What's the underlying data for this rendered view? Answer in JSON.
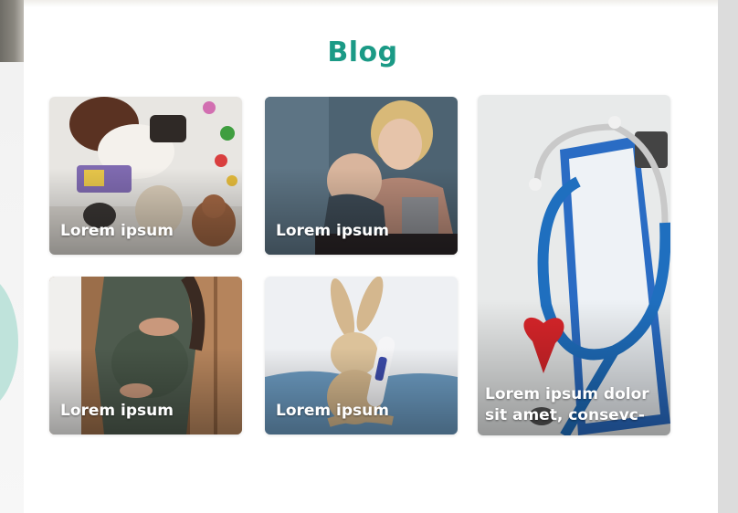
{
  "blog": {
    "title": "Blog",
    "posts": [
      {
        "caption": "Lorem ipsum",
        "image": "child-playing-with-toys"
      },
      {
        "caption": "Lorem ipsum",
        "image": "mother-holding-baby"
      },
      {
        "caption": "Lorem ipsum dolor sit amet, consevc-",
        "image": "stethoscope-and-heart"
      },
      {
        "caption": "Lorem ipsum",
        "image": "pregnant-woman"
      },
      {
        "caption": "Lorem ipsum",
        "image": "plush-bunny-with-thermometer"
      }
    ]
  },
  "colors": {
    "title_teal": "#1b9a86",
    "caption_text": "#ffffff",
    "panel_background": "#ffffff"
  }
}
